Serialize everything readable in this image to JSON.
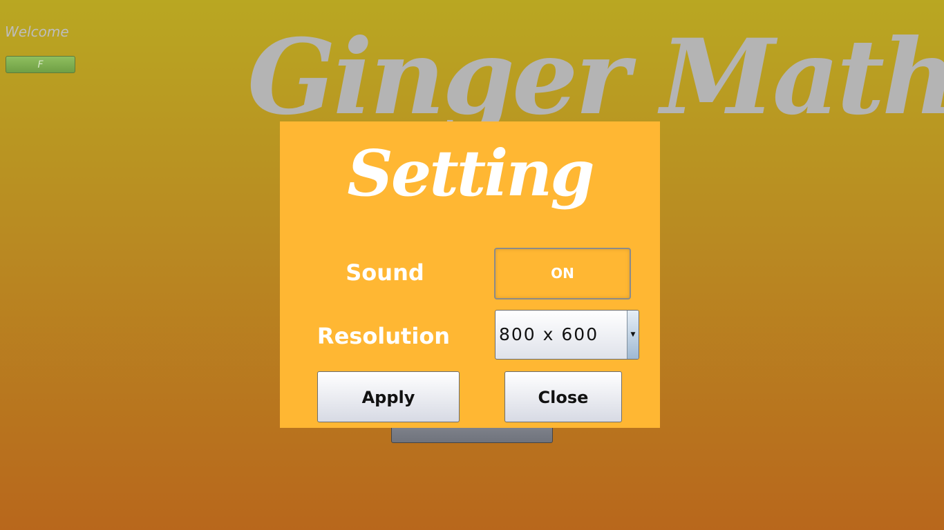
{
  "header": {
    "welcome_text": "Welcome",
    "user_button_label": "F"
  },
  "background": {
    "app_title": "Ginger Math"
  },
  "dialog": {
    "title": "Setting",
    "sound": {
      "label": "Sound",
      "value": "ON"
    },
    "resolution": {
      "label": "Resolution",
      "selected": "800 x 600"
    },
    "apply_label": "Apply",
    "close_label": "Close"
  },
  "colors": {
    "dialog_background": "#ffb733",
    "background_top": "#b9a722",
    "background_bottom": "#b8671c",
    "title_gray": "#b4b4b4",
    "text_white": "#ffffff"
  },
  "icons": {
    "dropdown_arrow": "triangle-down-icon"
  }
}
